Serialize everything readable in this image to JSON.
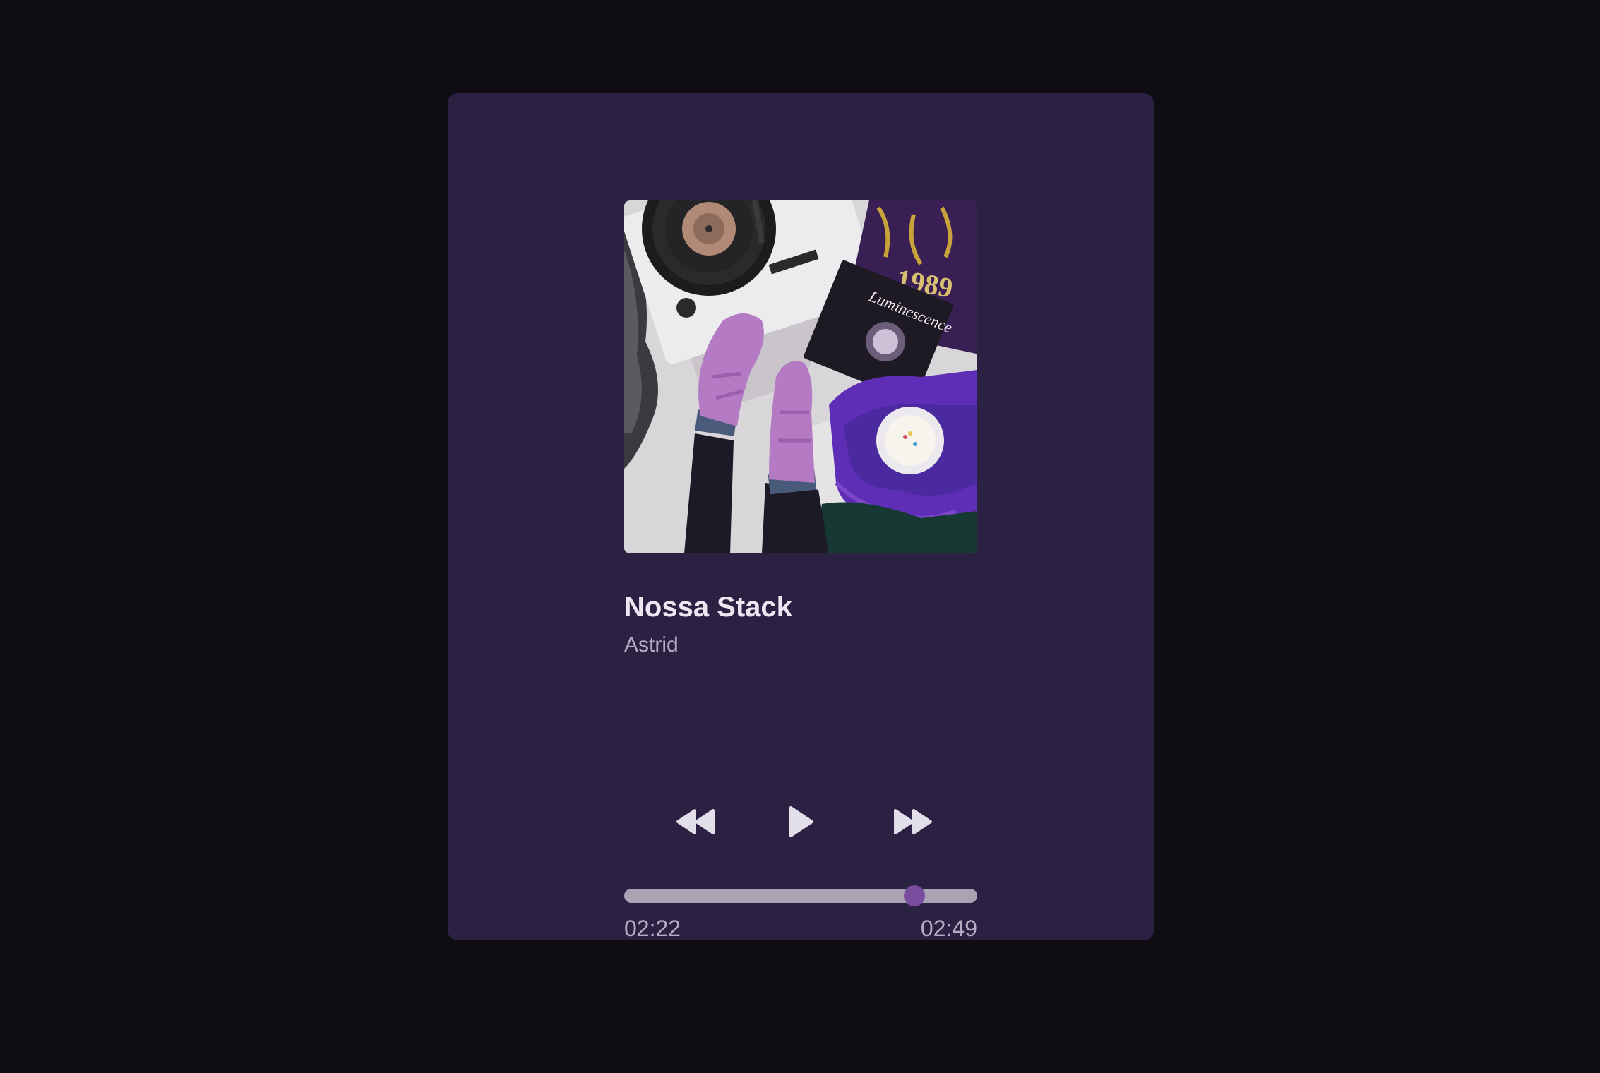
{
  "track": {
    "title": "Nossa Stack",
    "artist": "Astrid"
  },
  "cover": {
    "description_icon": "album-cover-image",
    "visible_text": [
      "Luminescence",
      "1989"
    ]
  },
  "controls": {
    "previous_icon": "rewind-icon",
    "play_icon": "play-icon",
    "next_icon": "fast-forward-icon"
  },
  "progress": {
    "current_time": "02:22",
    "total_time": "02:49",
    "fraction": 0.822
  },
  "colors": {
    "page_background": "#0f0c14",
    "card_background": "#2b2142",
    "accent": "#7a4c9d",
    "track": "#a9a3b4",
    "text_primary": "#ece8f2",
    "text_secondary": "#b5adc3"
  }
}
